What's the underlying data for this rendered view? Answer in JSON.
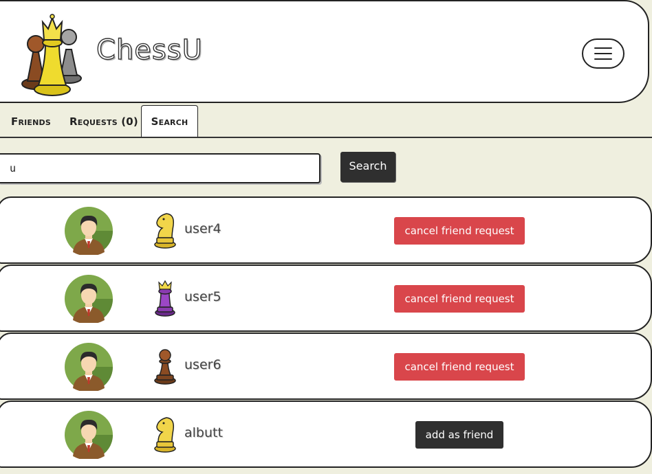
{
  "app": {
    "brand": "ChessU"
  },
  "tabs": [
    {
      "label": "Friends"
    },
    {
      "label": "Requests (0)"
    },
    {
      "label": "Search"
    }
  ],
  "search": {
    "value": "u",
    "button_label": "Search"
  },
  "results": [
    {
      "username": "user4",
      "piece": "knight-gold-icon",
      "action": "cancel friend request"
    },
    {
      "username": "user5",
      "piece": "queen-purple-icon",
      "action": "cancel friend request"
    },
    {
      "username": "user6",
      "piece": "pawn-brown-icon",
      "action": "cancel friend request"
    },
    {
      "username": "albutt",
      "piece": "knight-gold-icon",
      "action": "add as friend"
    }
  ],
  "colors": {
    "background": "#efefdf",
    "danger": "#d9464b",
    "dark_button": "#2f2f2f"
  }
}
